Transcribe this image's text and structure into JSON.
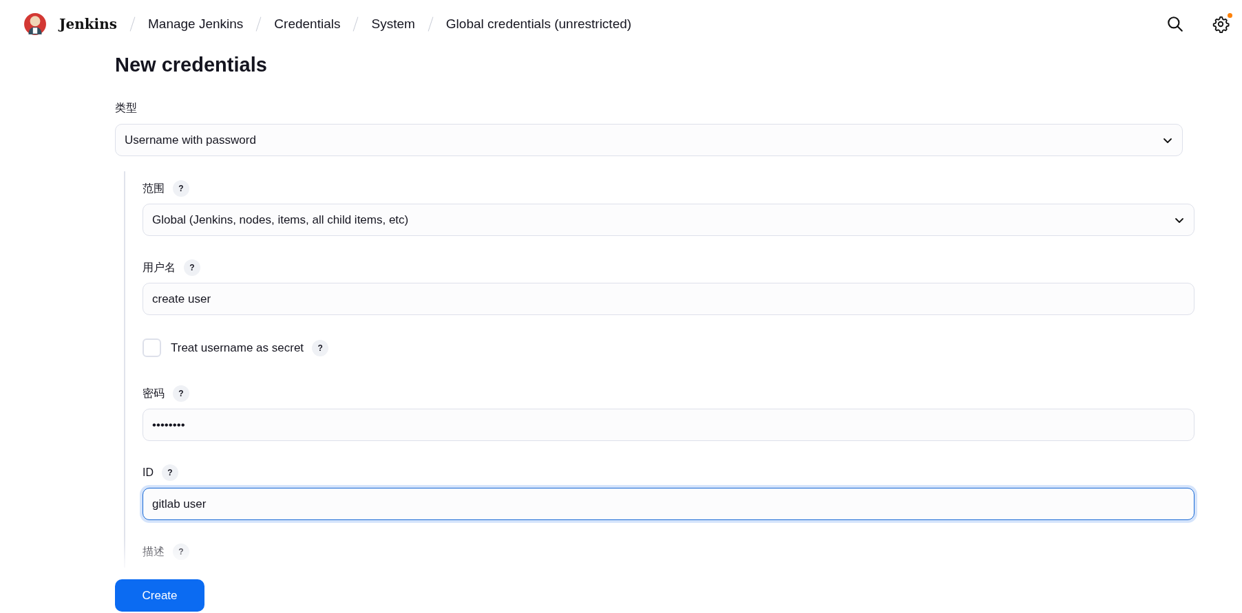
{
  "header": {
    "brand": "Jenkins",
    "breadcrumbs": [
      "Manage Jenkins",
      "Credentials",
      "System",
      "Global credentials (unrestricted)"
    ],
    "settings_notification": true
  },
  "title": "New credentials",
  "kind_field": {
    "label": "类型",
    "value": "Username with password"
  },
  "fields": [
    {
      "kind": "select",
      "label": "范围",
      "help": "?",
      "value": "Global (Jenkins, nodes, items, all child items, etc)"
    },
    {
      "kind": "text",
      "label": "用户名",
      "help": "?",
      "value": "create user"
    },
    {
      "kind": "checkbox",
      "label": "Treat username as secret",
      "help": "?",
      "checked": false
    },
    {
      "kind": "text",
      "label": "密码",
      "help": "?",
      "value": "••••••••"
    },
    {
      "kind": "text",
      "label": "ID",
      "help": "?",
      "value": "gitlab user",
      "focused": true
    },
    {
      "kind": "label",
      "label": "描述",
      "help": "?"
    }
  ],
  "create_button": "Create"
}
